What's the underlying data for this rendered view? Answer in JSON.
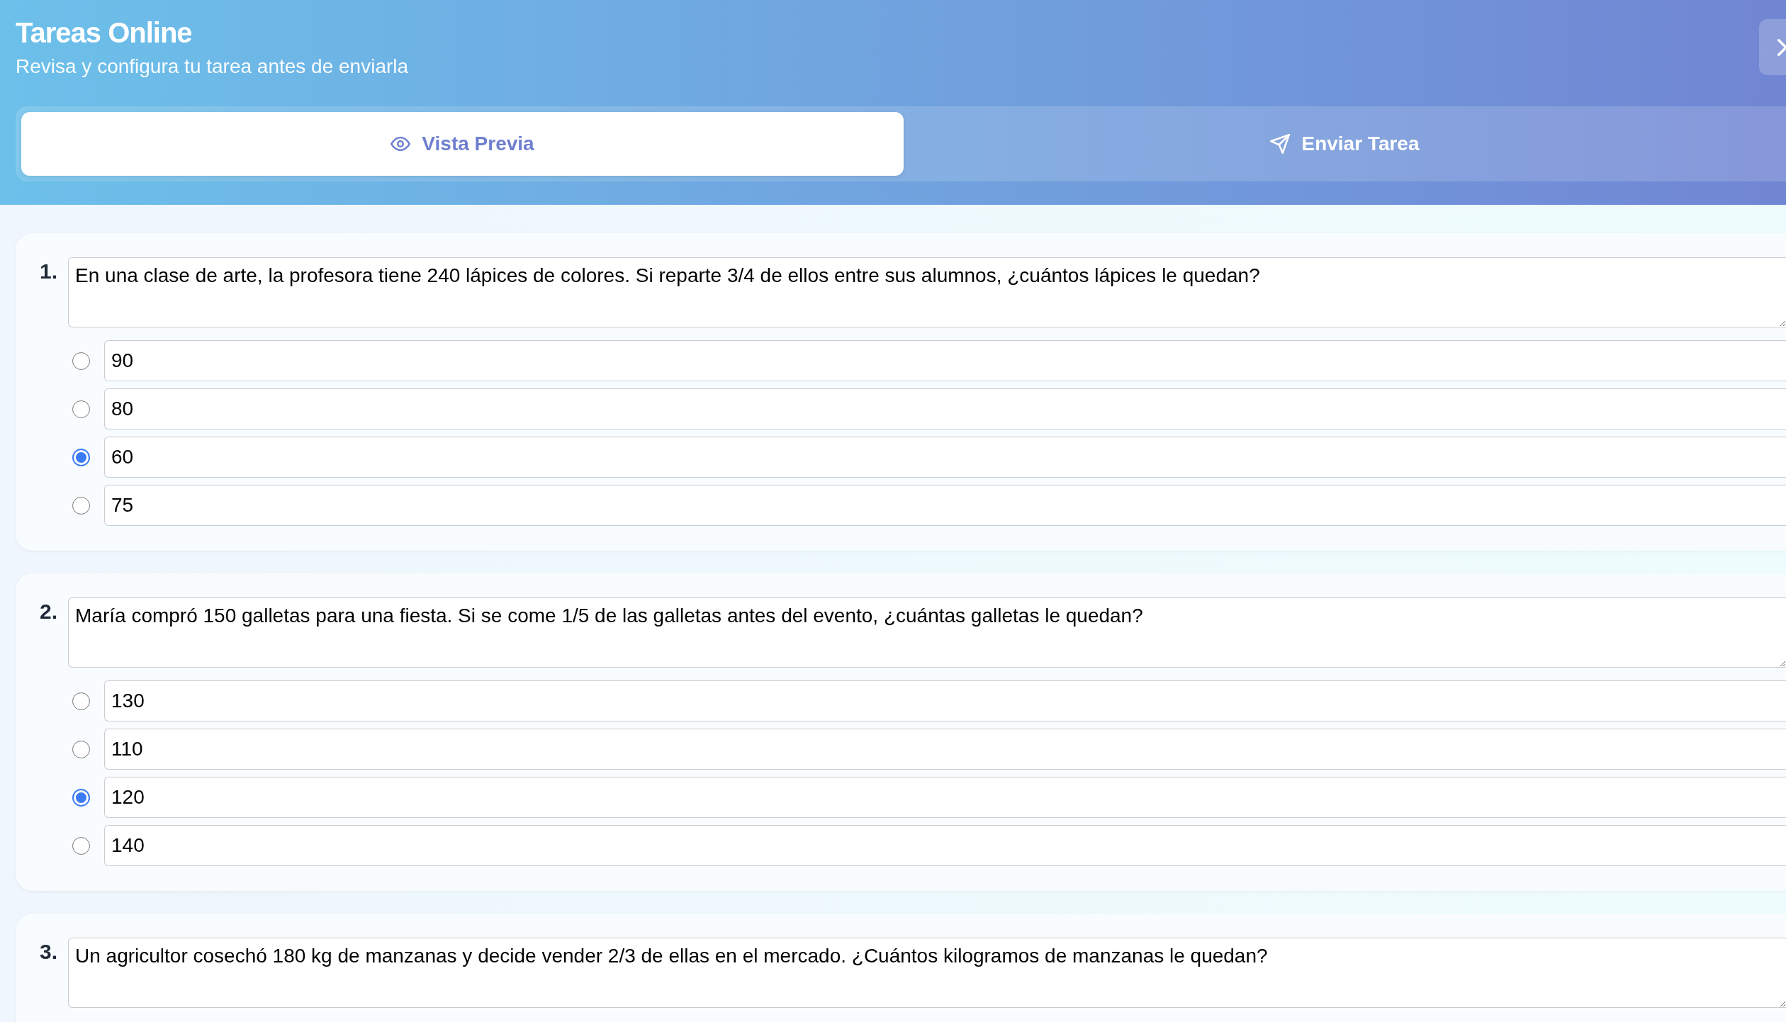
{
  "header": {
    "title": "Tareas Online",
    "subtitle": "Revisa y configura tu tarea antes de enviarla"
  },
  "tabs": [
    {
      "kind": "preview",
      "label": "Vista Previa",
      "selected": true
    },
    {
      "kind": "send",
      "label": "Enviar Tarea",
      "selected": false
    }
  ],
  "questions": [
    {
      "number": "1.",
      "text": "En una clase de arte, la profesora tiene 240 lápices de colores. Si reparte 3/4 de ellos entre sus alumnos, ¿cuántos lápices le quedan?",
      "options": [
        {
          "value": "90",
          "selected": false
        },
        {
          "value": "80",
          "selected": false
        },
        {
          "value": "60",
          "selected": true
        },
        {
          "value": "75",
          "selected": false
        }
      ]
    },
    {
      "number": "2.",
      "text": "María compró 150 galletas para una fiesta. Si se come 1/5 de las galletas antes del evento, ¿cuántas galletas le quedan?",
      "options": [
        {
          "value": "130",
          "selected": false
        },
        {
          "value": "110",
          "selected": false
        },
        {
          "value": "120",
          "selected": true
        },
        {
          "value": "140",
          "selected": false
        }
      ]
    },
    {
      "number": "3.",
      "text": "Un agricultor cosechó 180 kg de manzanas y decide vender 2/3 de ellas en el mercado. ¿Cuántos kilogramos de manzanas le quedan?"
    }
  ]
}
